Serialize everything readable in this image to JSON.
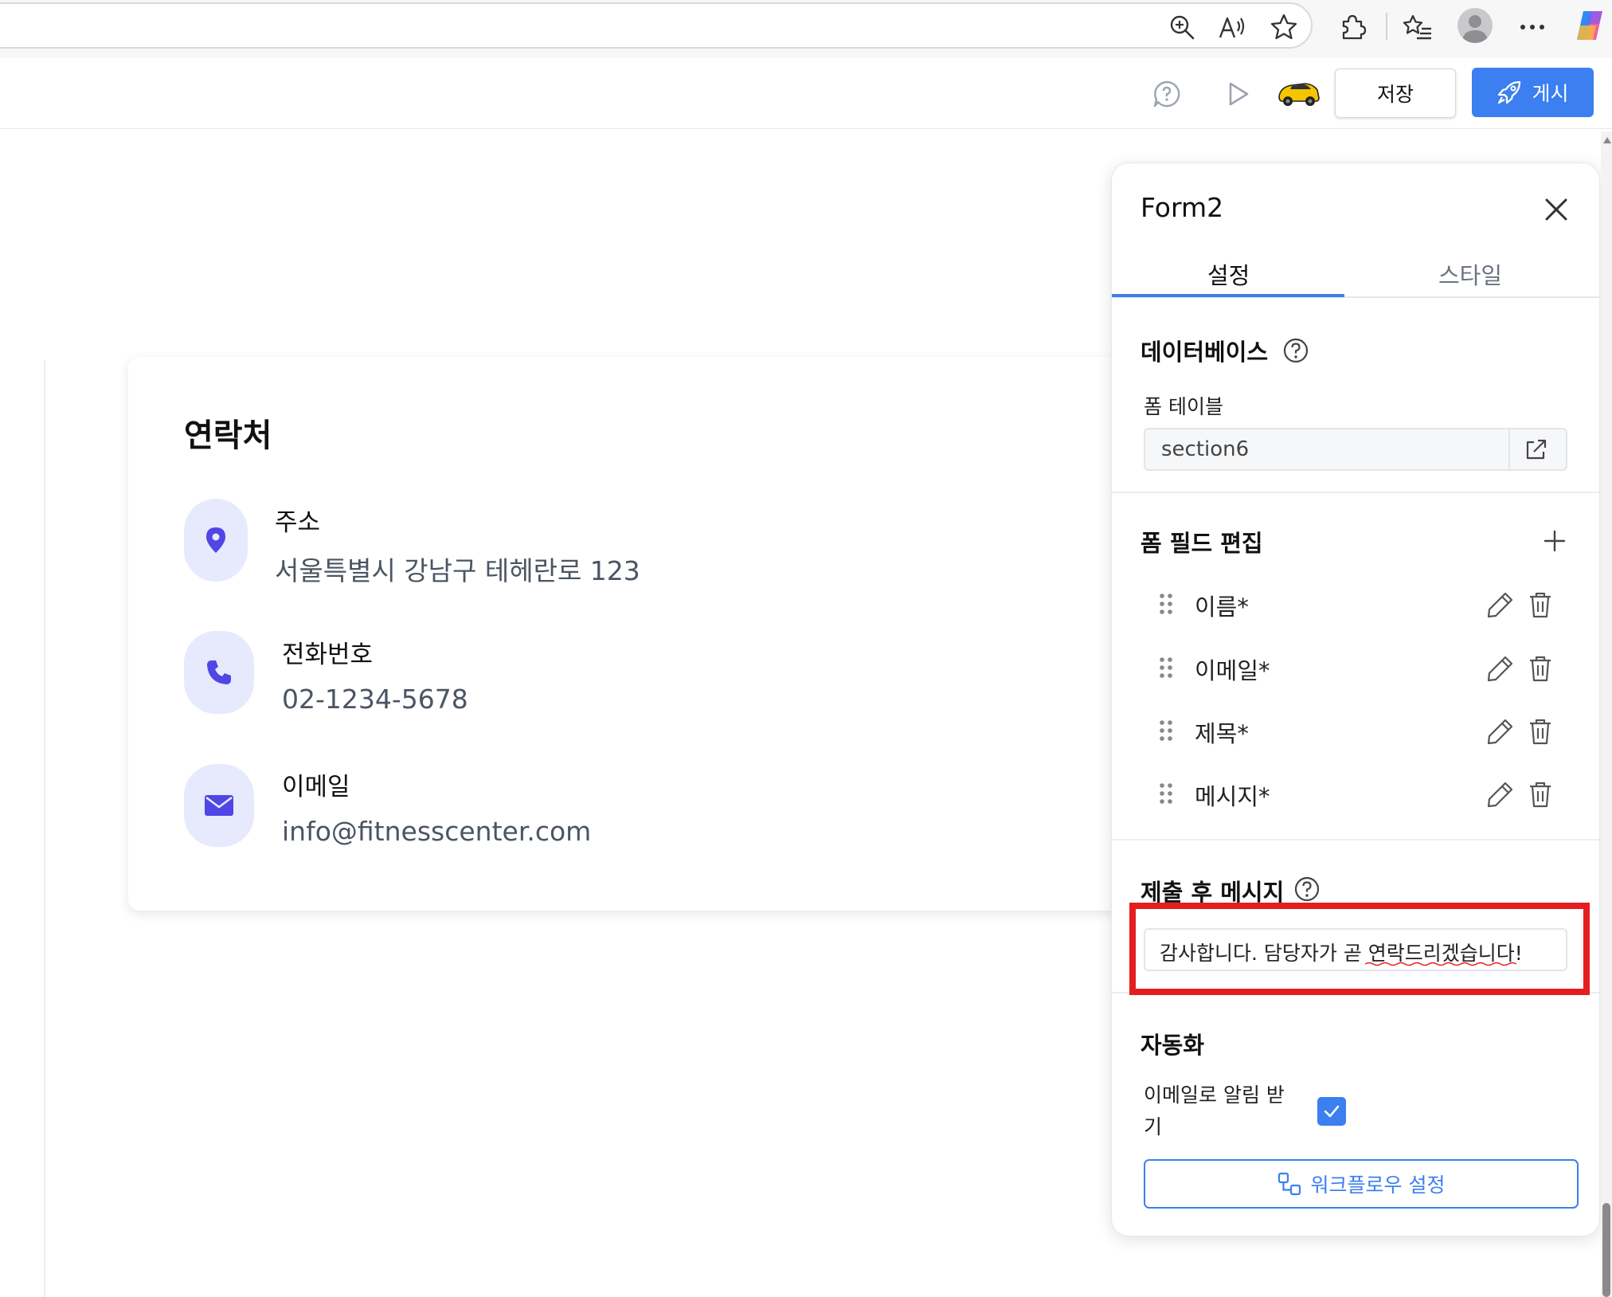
{
  "browser": {
    "toolbar_icons": [
      "zoom-icon",
      "read-aloud-icon",
      "favorite-star-icon",
      "extensions-icon",
      "favorites-list-icon",
      "profile-avatar",
      "more-menu-icon",
      "copilot-icon"
    ]
  },
  "editor_toolbar": {
    "save_label": "저장",
    "publish_label": "게시",
    "icons": [
      "feedback-icon",
      "preview-play-icon",
      "user-avatar-car",
      "rocket-icon"
    ],
    "accent_color": "#3b7ff0"
  },
  "contact_section": {
    "title": "연락처",
    "items": [
      {
        "icon": "location-pin-icon",
        "label": "주소",
        "value": "서울특별시 강남구 테헤란로 123"
      },
      {
        "icon": "phone-icon",
        "label": "전화번호",
        "value": "02-1234-5678"
      },
      {
        "icon": "mail-icon",
        "label": "이메일",
        "value": "info@fitnesscenter.com"
      }
    ],
    "icon_color": "#4f46e5",
    "icon_bg_color": "#e7e9fd"
  },
  "panel": {
    "title": "Form2",
    "tabs": [
      {
        "label": "설정",
        "active": true
      },
      {
        "label": "스타일",
        "active": false
      }
    ],
    "database": {
      "title": "데이터베이스",
      "table_label": "폼 테이블",
      "table_value": "section6"
    },
    "form_fields": {
      "title": "폼 필드 편집",
      "items": [
        {
          "label": "이름*"
        },
        {
          "label": "이메일*"
        },
        {
          "label": "제목*"
        },
        {
          "label": "메시지*"
        }
      ]
    },
    "submit_message": {
      "title": "제출 후 메시지",
      "value": "감사합니다. 담당자가 곧 연락드리겠습니다!",
      "highlight_color": "#e41e1e"
    },
    "automation": {
      "title": "자동화",
      "notify_label": "이메일로 알림 받기",
      "notify_checked": true,
      "workflow_button": "워크플로우 설정"
    }
  }
}
